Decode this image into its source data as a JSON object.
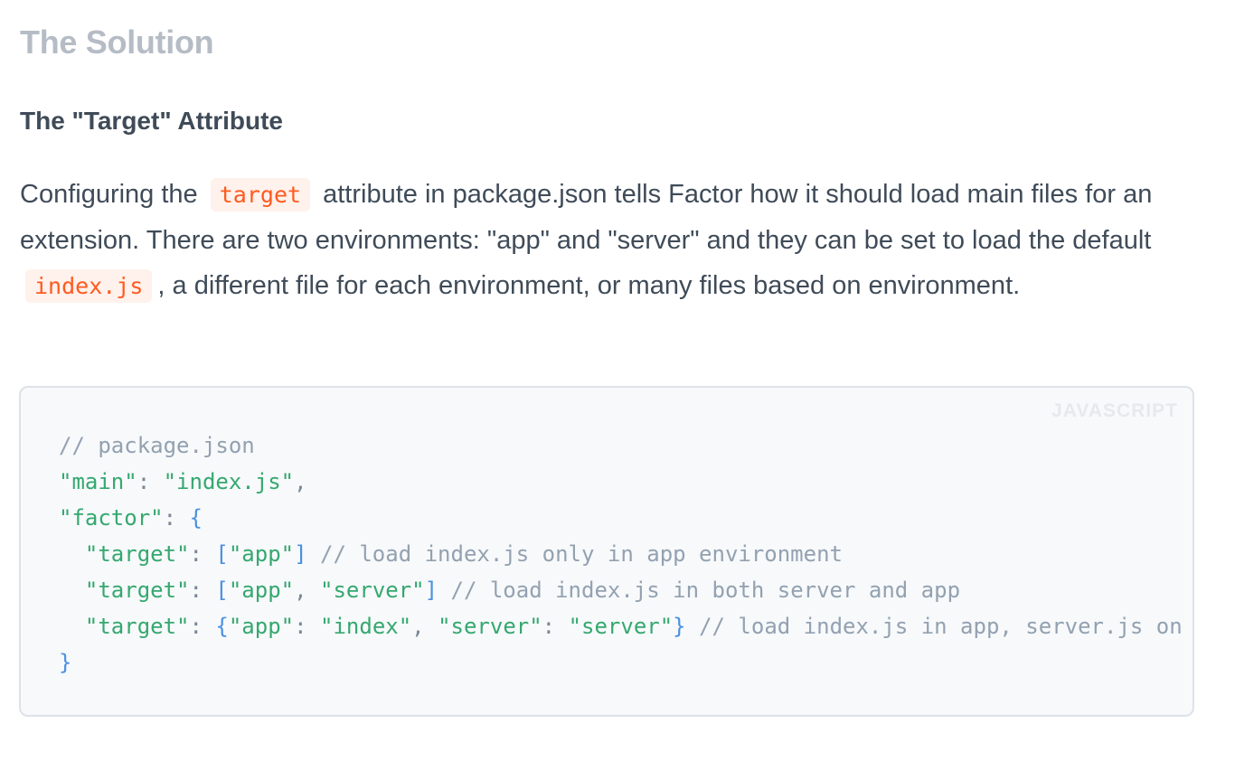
{
  "section_title": "The Solution",
  "subsection_title": "The \"Target\" Attribute",
  "paragraph": {
    "part1": "Configuring the",
    "code1": "target",
    "part2": "attribute in package.json tells Factor how it should load main files for an extension. There are two environments: \"app\" and \"server\" and they can be set to load the default",
    "code2": "index.js",
    "part3": ", a different file for each environment, or many files based on environment."
  },
  "code_block": {
    "language": "JAVASCRIPT",
    "line1_comment": "// package.json",
    "line2_key": "\"main\"",
    "line2_colon": ": ",
    "line2_value": "\"index.js\"",
    "line2_end": ",",
    "line3_key": "\"factor\"",
    "line3_colon": ": ",
    "line3_brace": "{",
    "line4_indent": "  ",
    "line4_key": "\"target\"",
    "line4_colon": ": ",
    "line4_open": "[",
    "line4_v1": "\"app\"",
    "line4_close": "]",
    "line4_comment": " // load index.js only in app environment",
    "line5_indent": "  ",
    "line5_key": "\"target\"",
    "line5_colon": ": ",
    "line5_open": "[",
    "line5_v1": "\"app\"",
    "line5_sep": ", ",
    "line5_v2": "\"server\"",
    "line5_close": "]",
    "line5_comment": " // load index.js in both server and app",
    "line6_indent": "  ",
    "line6_key": "\"target\"",
    "line6_colon": ": ",
    "line6_open": "{",
    "line6_k1": "\"app\"",
    "line6_c1": ": ",
    "line6_v1": "\"index\"",
    "line6_sep": ", ",
    "line6_k2": "\"server\"",
    "line6_c2": ": ",
    "line6_v2": "\"server\"",
    "line6_close": "}",
    "line6_comment": " // load index.js in app, server.js on server",
    "line7_brace": "}"
  },
  "colors": {
    "inline_code_text": "#ff5a1f",
    "inline_code_bg": "#fff1eb",
    "string": "#35a86f",
    "punctuation": "#4a90e2",
    "comment": "#93a1b0"
  }
}
